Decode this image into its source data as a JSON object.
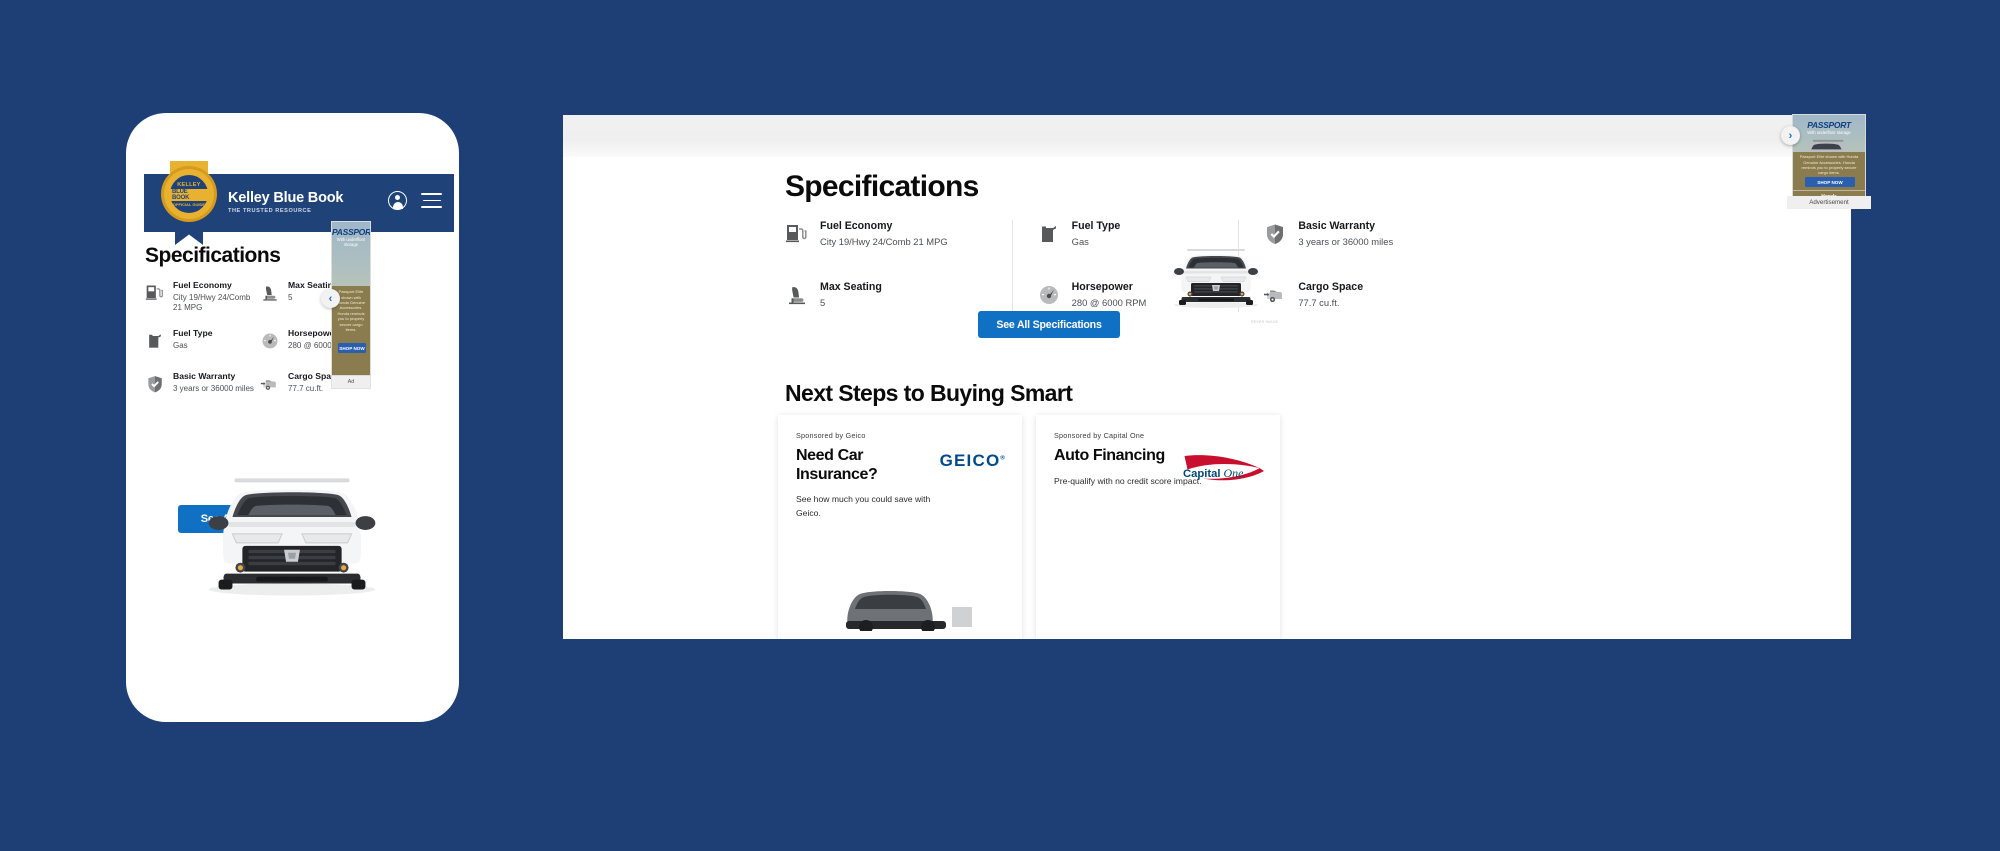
{
  "theme": {
    "page_background": "#1e3f75",
    "accent_blue": "#1071c4",
    "header_navy": "#1f4379",
    "gold": "#e8b230"
  },
  "mobile": {
    "header": {
      "brand_name": "Kelley Blue Book",
      "brand_tagline": "THE TRUSTED RESOURCE",
      "logo_line1": "KELLEY",
      "logo_line2": "BLUE BOOK",
      "logo_line3": "OFFICIAL GUIDE",
      "account_icon": "account-icon",
      "menu_icon": "hamburger-icon"
    },
    "title": "Specifications",
    "specs": [
      {
        "label": "Fuel Economy",
        "value": "City 19/Hwy 24/Comb 21 MPG",
        "icon": "fuel-pump-icon"
      },
      {
        "label": "Max Seating",
        "value": "5",
        "icon": "car-seat-icon"
      },
      {
        "label": "Fuel Type",
        "value": "Gas",
        "icon": "fuel-can-icon"
      },
      {
        "label": "Horsepower",
        "value": "280 @ 6000 RPM",
        "icon": "gauge-icon"
      },
      {
        "label": "Basic Warranty",
        "value": "3 years or 36000 miles",
        "icon": "shield-check-icon"
      },
      {
        "label": "Cargo Space",
        "value": "77.7 cu.ft.",
        "icon": "cargo-van-icon"
      }
    ],
    "cta_label": "See All Specifications",
    "ad_label": "Ad",
    "carousel_prev": "‹",
    "vehicle_alt": "white-honda-passport-front"
  },
  "desktop": {
    "title": "Specifications",
    "specs_columns": [
      [
        {
          "label": "Fuel Economy",
          "value": "City 19/Hwy 24/Comb 21 MPG",
          "icon": "fuel-pump-icon"
        },
        {
          "label": "Max Seating",
          "value": "5",
          "icon": "car-seat-icon"
        }
      ],
      [
        {
          "label": "Fuel Type",
          "value": "Gas",
          "icon": "fuel-can-icon"
        },
        {
          "label": "Horsepower",
          "value": "280 @ 6000 RPM",
          "icon": "gauge-icon"
        }
      ],
      [
        {
          "label": "Basic Warranty",
          "value": "3 years or 36000 miles",
          "icon": "shield-check-icon"
        },
        {
          "label": "Cargo Space",
          "value": "77.7 cu.ft.",
          "icon": "cargo-van-icon"
        }
      ]
    ],
    "cta_label": "See All Specifications",
    "vehicle_alt": "white-honda-passport-front",
    "vehicle_watermark": "REVER IMAGE",
    "next_steps_title": "Next Steps to Buying Smart",
    "cards": [
      {
        "sponsor": "Sponsored by Geico",
        "headline": "Need Car Insurance?",
        "body": "See how much you could save with Geico.",
        "logo_text": "GEICO",
        "logo_mark": "geico-logo"
      },
      {
        "sponsor": "Sponsored by Capital One",
        "headline": "Auto Financing",
        "body": "Pre-qualify with no credit score impact.",
        "logo_text": "CapitalOne",
        "logo_mark": "capital-one-logo"
      }
    ],
    "ad": {
      "title": "PASSPORT",
      "subtitle": "With underfloor storage",
      "copy": "Passport Elite shown with Honda Genuine Accessories. Honda reminds you to properly secure cargo items.",
      "cta": "SHOP NOW",
      "brand": "Honda",
      "label": "Advertisement",
      "carousel_next": "›"
    }
  }
}
